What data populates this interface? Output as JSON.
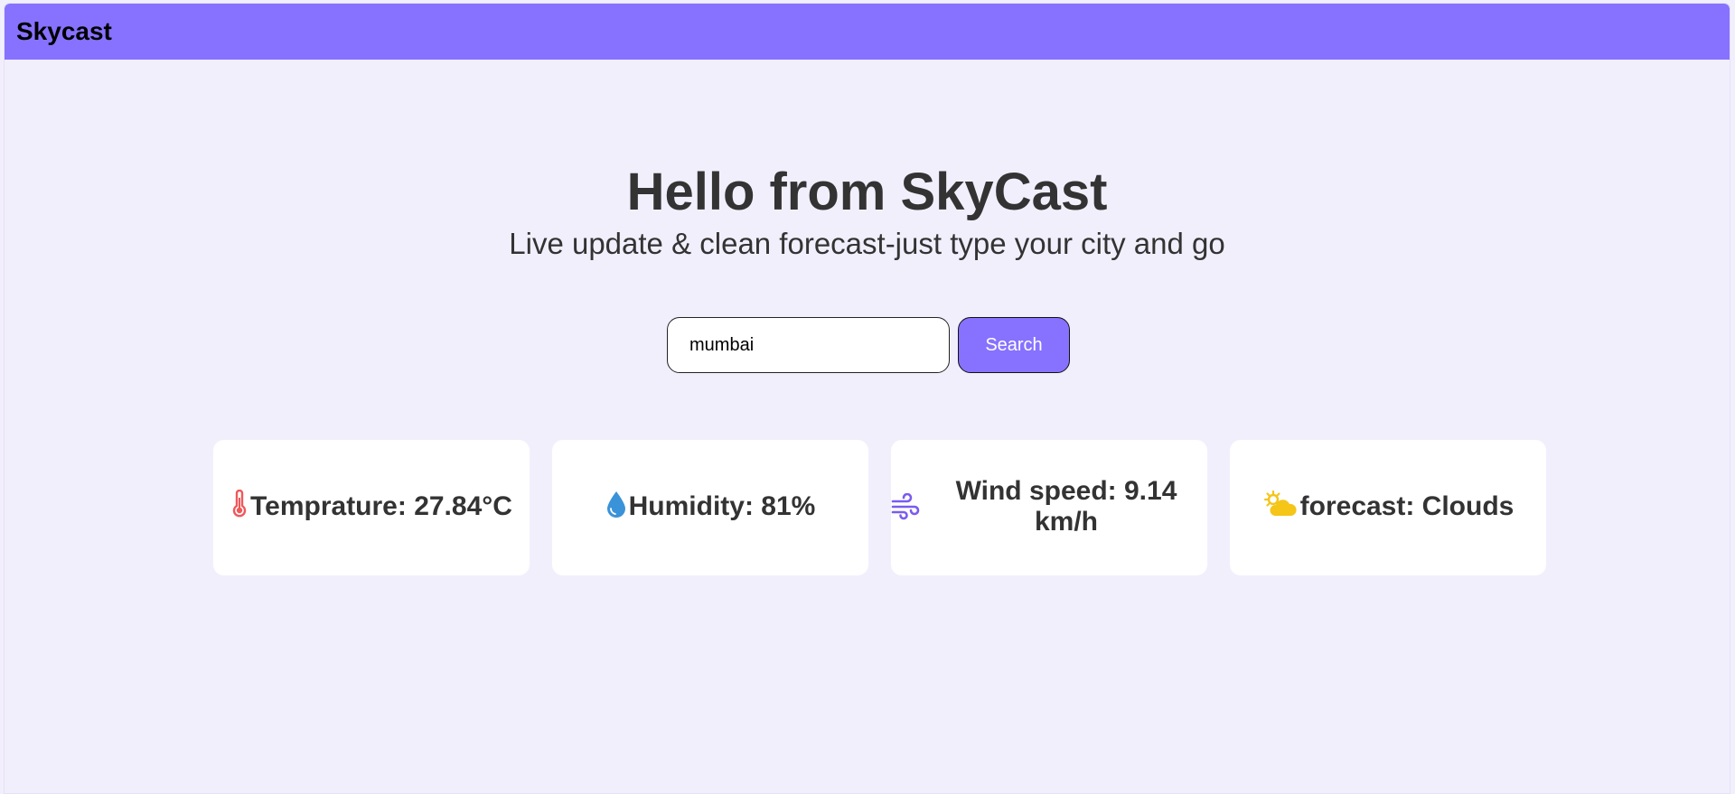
{
  "navbar": {
    "brand": "Skycast",
    "background": "#8672ff"
  },
  "hero": {
    "title": "Hello from SkyCast",
    "subtitle": "Live update & clean forecast-just type your city and go"
  },
  "search": {
    "value": "mumbai",
    "button_label": "Search"
  },
  "cards": [
    {
      "icon": "thermometer-icon",
      "text": "Temprature: 27.84°C"
    },
    {
      "icon": "droplet-icon",
      "text": "Humidity: 81%"
    },
    {
      "icon": "wind-icon",
      "text": "Wind speed: 9.14 km/h"
    },
    {
      "icon": "sun-cloud-icon",
      "text": "forecast: Clouds"
    }
  ],
  "colors": {
    "accent": "#8672ff",
    "page_background": "#f2effd",
    "card_background": "#ffffff",
    "thermometer": "#f0585a",
    "droplet": "#3a93d8",
    "wind": "#7a5cf0",
    "sun": "#f5c518"
  }
}
